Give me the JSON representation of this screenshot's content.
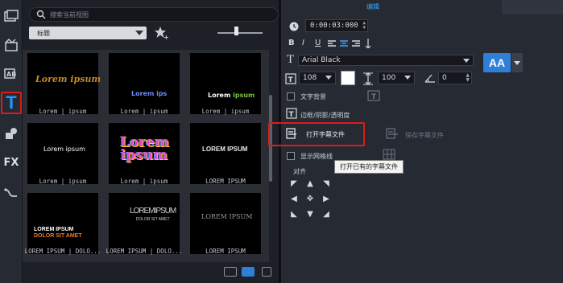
{
  "library": {
    "search_placeholder": "搜索当前视图",
    "category": "标题",
    "items": [
      {
        "caption": "Lorem | ipsum",
        "preview_text": "Lorem ipsum",
        "style": "script-gold"
      },
      {
        "caption": "Lorem | ipsum",
        "preview_text": "Lorem ips",
        "style": "blue-bold"
      },
      {
        "caption": "Lorem | ipsum",
        "preview_text": "Lorem ipsum",
        "style": "white-green"
      },
      {
        "caption": "Lorem | ipsum",
        "preview_text": "Lorem ipsum",
        "style": "white-small"
      },
      {
        "caption": "Lorem | ipsum",
        "preview_text_1": "Lorem",
        "preview_text_2": "ipsum",
        "style": "rainbow-3d"
      },
      {
        "caption": "LOREM IPSUM",
        "preview_text": "LOREM IPSUM",
        "style": "white-caps"
      },
      {
        "caption": "LOREM IPSUM | DOLO...",
        "preview_text_1": "LOREM IPSUM",
        "preview_text_2": "DOLOR SIT AMET",
        "style": "white-orange"
      },
      {
        "caption": "LOREM IPSUM | DOLO...",
        "preview_text_1": "LOREMIPSUM",
        "preview_text_2": "DOLOR SIT AMET",
        "style": "condensed-gray"
      },
      {
        "caption": "LOREM IPSUM",
        "preview_text": "LOREM IPSUM",
        "style": "serif-gray"
      }
    ]
  },
  "options": {
    "tab_label": "编辑",
    "duration": "0:00:03:000",
    "font": "Arial Black",
    "size": "108",
    "line_spacing": "100",
    "rotation": "0",
    "text_background_label": "文字背景",
    "border_shadow_label": "边框/阴影/透明度",
    "open_subtitle_label": "打开字幕文件",
    "save_subtitle_label": "保存字幕文件",
    "show_grid_label": "显示网格线",
    "tooltip": "打开已有的字幕文件",
    "align_label": "对齐",
    "aa_label": "AA"
  },
  "colors": {
    "accent": "#1e9bff",
    "highlight_red": "#e01b1b",
    "text_color": "#ffffff"
  }
}
